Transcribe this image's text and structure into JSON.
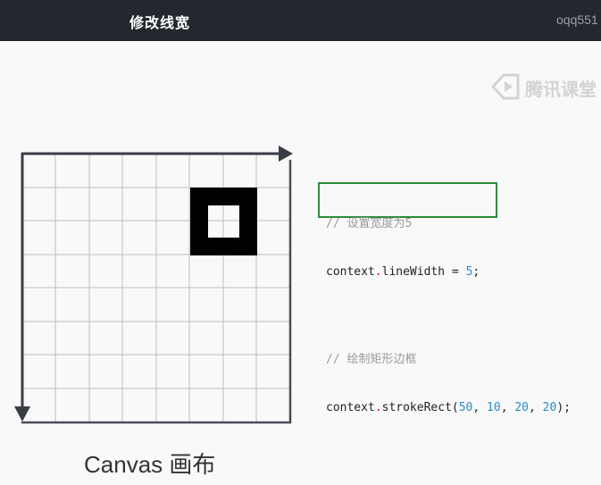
{
  "header": {
    "title": "修改线宽",
    "user": "oqq551"
  },
  "watermark": {
    "text": "腾讯课堂",
    "icon": "play-logo-icon"
  },
  "canvas_demo": {
    "caption": "Canvas 画布",
    "grid_rows": 8,
    "grid_cols": 8
  },
  "code": {
    "comment1": "// 设置宽度为5",
    "line1_obj": "context",
    "line1_dot": ".",
    "line1_prop": "lineWidth",
    "line1_eq": " = ",
    "line1_val": "5",
    "line1_end": ";",
    "comment2": "// 绘制矩形边框",
    "line2_obj": "context",
    "line2_dot": ".",
    "line2_fn": "strokeRect(",
    "arg1": "50",
    "arg2": "10",
    "arg3": "20",
    "arg4": "20",
    "sep": ", ",
    "line2_end": ");"
  },
  "colors": {
    "topbar": "#23272e",
    "highlight": "#2e8b3a",
    "number": "#2a8dc9"
  }
}
